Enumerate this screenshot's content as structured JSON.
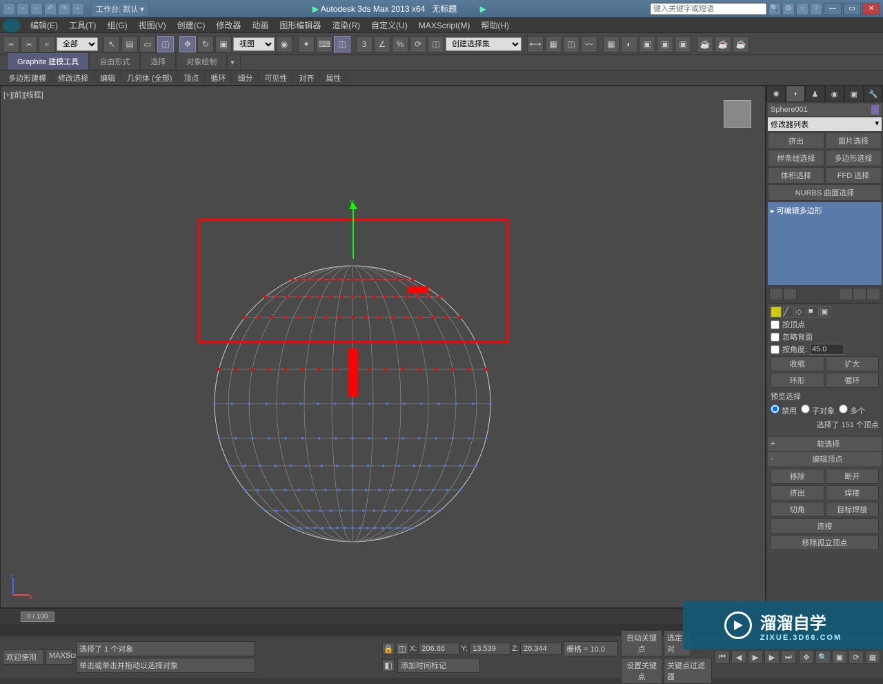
{
  "titlebar": {
    "workspace": "工作台: 默认",
    "app_title": "Autodesk 3ds Max  2013 x64",
    "doc_title": "无标题",
    "search_placeholder": "键入关键字或短语"
  },
  "menubar": {
    "items": [
      "编辑(E)",
      "工具(T)",
      "组(G)",
      "视图(V)",
      "创建(C)",
      "修改器",
      "动画",
      "图形编辑器",
      "渲染(R)",
      "自定义(U)",
      "MAXScript(M)",
      "帮助(H)"
    ]
  },
  "toolbar": {
    "filter": "全部",
    "ref_coord": "视图",
    "named_set": "创建选择集"
  },
  "ribbon": {
    "tabs": [
      "Graphite 建模工具",
      "自由形式",
      "选择",
      "对象绘制"
    ],
    "sub_items": [
      "多边形建模",
      "修改选择",
      "编辑",
      "几何体 (全部)",
      "顶点",
      "循环",
      "细分",
      "可见性",
      "对齐",
      "属性"
    ]
  },
  "viewport": {
    "label": "[+][前][线框]",
    "gizmo_y": "y"
  },
  "panel": {
    "object_name": "Sphere001",
    "modifier_list": "修改器列表",
    "mod_buttons": [
      "挤出",
      "面片选择",
      "样条线选择",
      "多边形选择",
      "体积选择",
      "FFD 选择",
      "NURBS 曲面选择"
    ],
    "stack_item": "可编辑多边形",
    "selection": {
      "by_vertex": "按顶点",
      "ignore_backfacing": "忽略背面",
      "by_angle": "按角度:",
      "angle_value": "45.0",
      "shrink": "收缩",
      "grow": "扩大",
      "ring": "环形",
      "loop": "循环",
      "preview_label": "预览选择",
      "preview_options": [
        "禁用",
        "子对象",
        "多个"
      ],
      "selected_info": "选择了 151 个顶点"
    },
    "soft_sel": "软选择",
    "edit_vertex": {
      "header": "编辑顶点",
      "remove": "移除",
      "break": "断开",
      "extrude": "挤出",
      "weld": "焊接",
      "chamfer": "切角",
      "target_weld": "目标焊接",
      "connect": "连接",
      "remove_iso": "移除孤立顶点"
    }
  },
  "timeline": {
    "slider": "0 / 100"
  },
  "status": {
    "welcome": "欢迎使用",
    "script": "MAXScr",
    "selection_info": "选择了 1 个对象",
    "hint": "单击或单击并拖动以选择对象",
    "x_label": "X:",
    "x_value": "206.86",
    "y_label": "Y:",
    "y_value": "13.539",
    "z_label": "Z:",
    "z_value": "26.344",
    "grid": "栅格 = 10.0",
    "add_time_tag": "添加时间标记",
    "auto_key": "自动关键点",
    "set_key": "设置关键点",
    "selected_filter": "选定对",
    "key_filter": "关键点过滤器"
  },
  "watermark": {
    "text": "溜溜自学",
    "url": "ZIXUE.3D66.COM"
  }
}
